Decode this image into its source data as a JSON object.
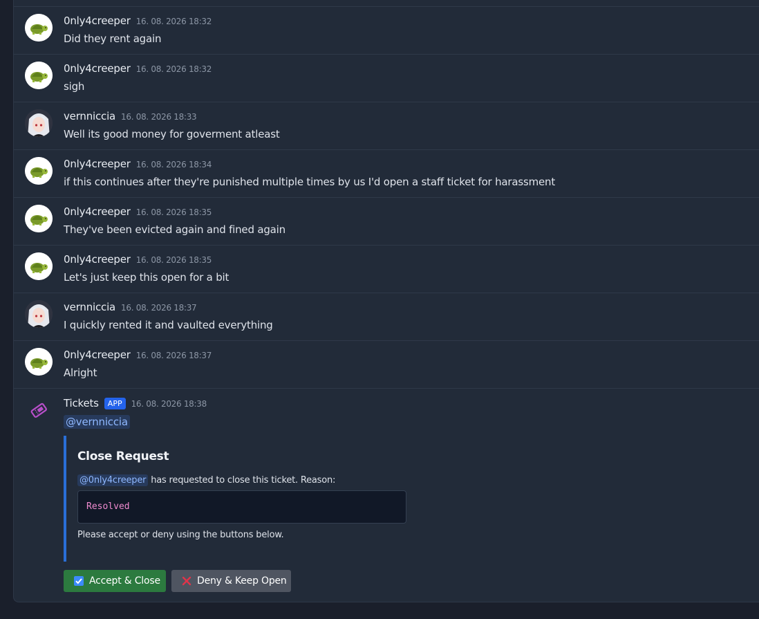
{
  "messages": [
    {
      "author": "0nly4creeper",
      "timestamp": "16. 08. 2026 18:32",
      "text": "Did they rent again",
      "avatar": "turtle-avatar"
    },
    {
      "author": "0nly4creeper",
      "timestamp": "16. 08. 2026 18:32",
      "text": "sigh",
      "avatar": "turtle-avatar"
    },
    {
      "author": "vernniccia",
      "timestamp": "16. 08. 2026 18:33",
      "text": "Well its good money for goverment atleast",
      "avatar": "anime-girl-avatar"
    },
    {
      "author": "0nly4creeper",
      "timestamp": "16. 08. 2026 18:34",
      "text": "if this continues after they're punished multiple times by us I'd open a staff ticket for harassment",
      "avatar": "turtle-avatar"
    },
    {
      "author": "0nly4creeper",
      "timestamp": "16. 08. 2026 18:35",
      "text": "They've been evicted again and fined again",
      "avatar": "turtle-avatar"
    },
    {
      "author": "0nly4creeper",
      "timestamp": "16. 08. 2026 18:35",
      "text": "Let's just keep this open for a bit",
      "avatar": "turtle-avatar"
    },
    {
      "author": "vernniccia",
      "timestamp": "16. 08. 2026 18:37",
      "text": "I quickly rented it and vaulted everything",
      "avatar": "anime-girl-avatar"
    },
    {
      "author": "0nly4creeper",
      "timestamp": "16. 08. 2026 18:37",
      "text": "Alright",
      "avatar": "turtle-avatar"
    }
  ],
  "bot_message": {
    "author": "Tickets",
    "badge": "APP",
    "timestamp": "16. 08. 2026 18:38",
    "mention": "@vernniccia",
    "icon": "ticket-icon",
    "embed": {
      "title": "Close Request",
      "requester_mention": "@0nly4creeper",
      "description": " has requested to close this ticket. Reason:",
      "reason": "Resolved",
      "footer": "Please accept or deny using the buttons below.",
      "accent_color": "#2a6fd7"
    },
    "buttons": {
      "accept_label": "Accept & Close",
      "deny_label": "Deny & Keep Open"
    }
  },
  "colors": {
    "background": "#1a1f2b",
    "panel": "#222b39",
    "accept": "#2c7a3f",
    "deny": "#4f5561",
    "app_badge": "#2463eb",
    "mention": "#8fb8ff"
  }
}
